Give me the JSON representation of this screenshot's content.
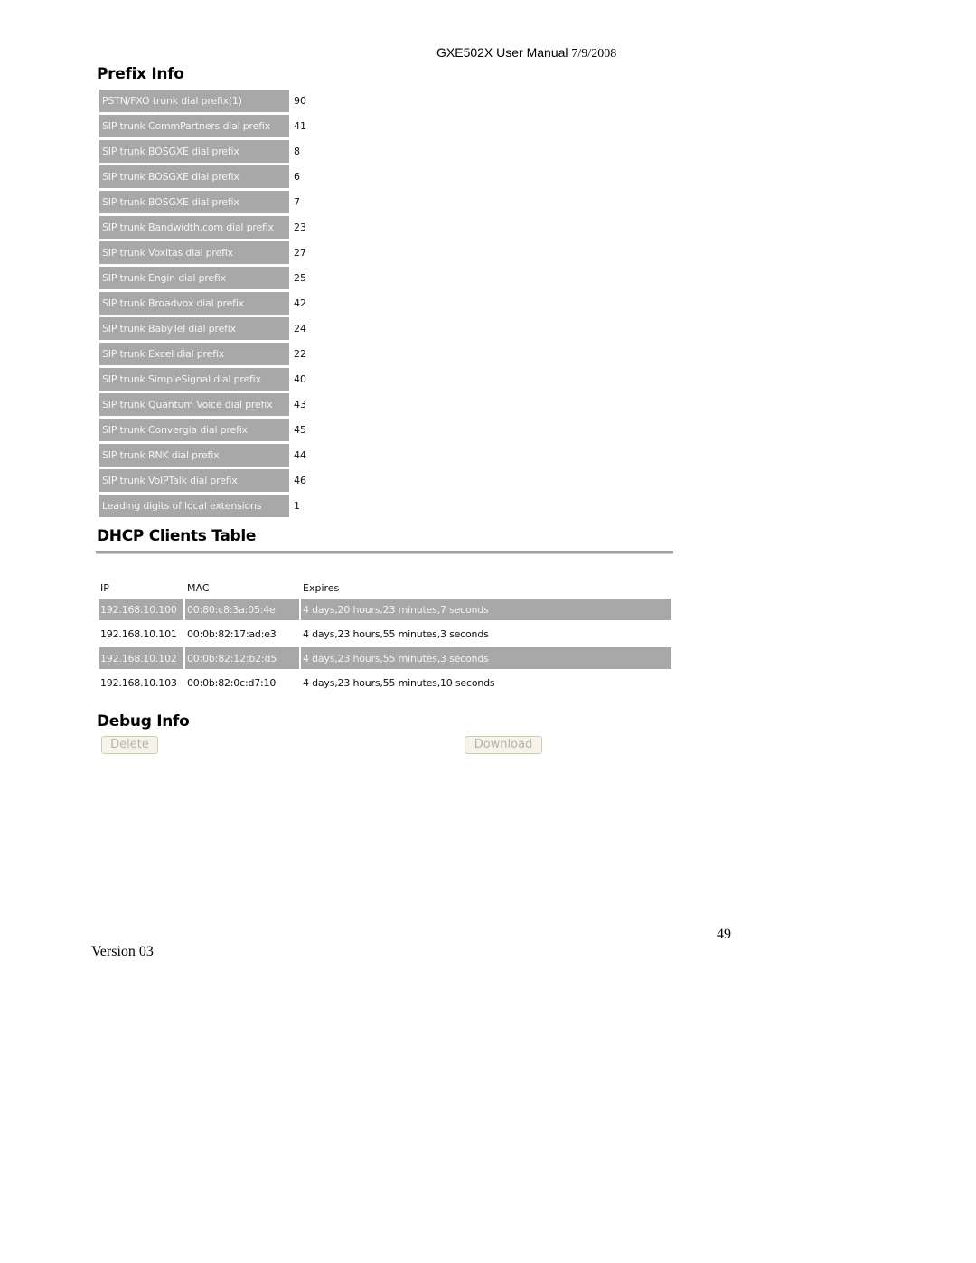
{
  "header": {
    "title": "GXE502X User Manual",
    "date": "7/9/2008"
  },
  "prefix_info": {
    "title": "Prefix Info",
    "rows": [
      {
        "label": "PSTN/FXO trunk dial prefix(1)",
        "value": "90"
      },
      {
        "label": "SIP trunk CommPartners dial prefix",
        "value": "41"
      },
      {
        "label": "SIP trunk BOSGXE dial prefix",
        "value": "8"
      },
      {
        "label": "SIP trunk BOSGXE dial prefix",
        "value": "6"
      },
      {
        "label": "SIP trunk BOSGXE dial prefix",
        "value": "7"
      },
      {
        "label": "SIP trunk Bandwidth.com dial prefix",
        "value": "23"
      },
      {
        "label": "SIP trunk Voxitas dial prefix",
        "value": "27"
      },
      {
        "label": "SIP trunk Engin dial prefix",
        "value": "25"
      },
      {
        "label": "SIP trunk Broadvox dial prefix",
        "value": "42"
      },
      {
        "label": "SIP trunk BabyTel dial prefix",
        "value": "24"
      },
      {
        "label": "SIP trunk Excel dial prefix",
        "value": "22"
      },
      {
        "label": "SIP trunk SimpleSignal dial prefix",
        "value": "40"
      },
      {
        "label": "SIP trunk Quantum Voice dial prefix",
        "value": "43"
      },
      {
        "label": "SIP trunk Convergia dial prefix",
        "value": "45"
      },
      {
        "label": "SIP trunk RNK dial prefix",
        "value": "44"
      },
      {
        "label": "SIP trunk VoIPTalk dial prefix",
        "value": "46"
      },
      {
        "label": "Leading digits of local extensions",
        "value": "1"
      }
    ]
  },
  "dhcp_clients": {
    "title": "DHCP Clients Table",
    "columns": [
      "IP",
      "MAC",
      "Expires"
    ],
    "rows": [
      {
        "ip": "192.168.10.100",
        "mac": "00:80:c8:3a:05:4e",
        "expires": "4 days,20 hours,23 minutes,7 seconds"
      },
      {
        "ip": "192.168.10.101",
        "mac": "00:0b:82:17:ad:e3",
        "expires": "4 days,23 hours,55 minutes,3 seconds"
      },
      {
        "ip": "192.168.10.102",
        "mac": "00:0b:82:12:b2:d5",
        "expires": "4 days,23 hours,55 minutes,3 seconds"
      },
      {
        "ip": "192.168.10.103",
        "mac": "00:0b:82:0c:d7:10",
        "expires": "4 days,23 hours,55 minutes,10 seconds"
      }
    ]
  },
  "debug_info": {
    "title": "Debug Info",
    "delete_label": "Delete",
    "download_label": "Download"
  },
  "footer": {
    "page_number": "49",
    "version": "Version 03"
  },
  "colors": {
    "shaded_cell": "#a8a8a8",
    "shaded_text": "#f4f4f4",
    "button_text_disabled": "#b8b4a0"
  }
}
